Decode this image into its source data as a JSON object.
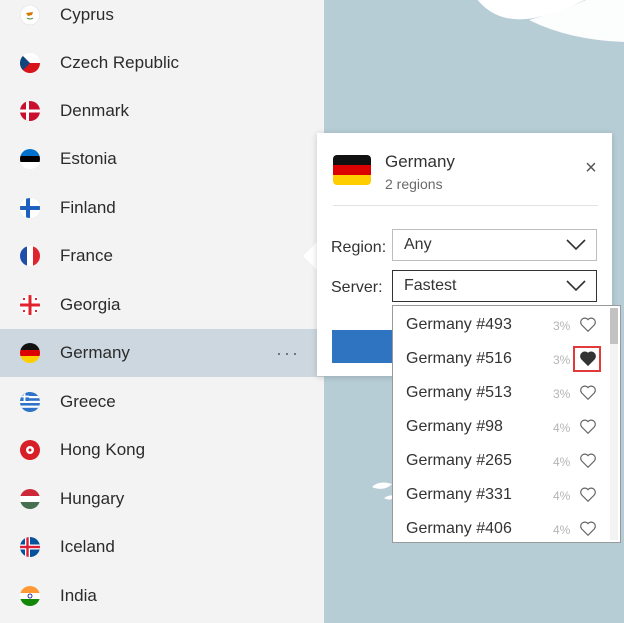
{
  "countries": [
    {
      "name": "Cyprus",
      "flag": "cyprus-flag-icon"
    },
    {
      "name": "Czech Republic",
      "flag": "czech-flag-icon"
    },
    {
      "name": "Denmark",
      "flag": "denmark-flag-icon"
    },
    {
      "name": "Estonia",
      "flag": "estonia-flag-icon"
    },
    {
      "name": "Finland",
      "flag": "finland-flag-icon"
    },
    {
      "name": "France",
      "flag": "france-flag-icon"
    },
    {
      "name": "Georgia",
      "flag": "georgia-flag-icon"
    },
    {
      "name": "Germany",
      "flag": "germany-flag-icon",
      "selected": true,
      "more": "···"
    },
    {
      "name": "Greece",
      "flag": "greece-flag-icon"
    },
    {
      "name": "Hong Kong",
      "flag": "hongkong-flag-icon"
    },
    {
      "name": "Hungary",
      "flag": "hungary-flag-icon"
    },
    {
      "name": "Iceland",
      "flag": "iceland-flag-icon"
    },
    {
      "name": "India",
      "flag": "india-flag-icon"
    }
  ],
  "popover": {
    "title": "Germany",
    "subtitle": "2 regions",
    "close_glyph": "×",
    "region_label": "Region:",
    "region_value": "Any",
    "server_label": "Server:",
    "server_value": "Fastest"
  },
  "servers": [
    {
      "name": "Germany #493",
      "load": "3%",
      "favorite": false
    },
    {
      "name": "Germany #516",
      "load": "3%",
      "favorite": true
    },
    {
      "name": "Germany #513",
      "load": "3%",
      "favorite": false
    },
    {
      "name": "Germany #98",
      "load": "4%",
      "favorite": false
    },
    {
      "name": "Germany #265",
      "load": "4%",
      "favorite": false
    },
    {
      "name": "Germany #331",
      "load": "4%",
      "favorite": false
    },
    {
      "name": "Germany #406",
      "load": "4%",
      "favorite": false
    }
  ],
  "colors": {
    "selected_row": "#cdd7df",
    "accent": "#2f74c0",
    "highlight_box": "#e03a3a",
    "map": "#b7cdd6"
  }
}
